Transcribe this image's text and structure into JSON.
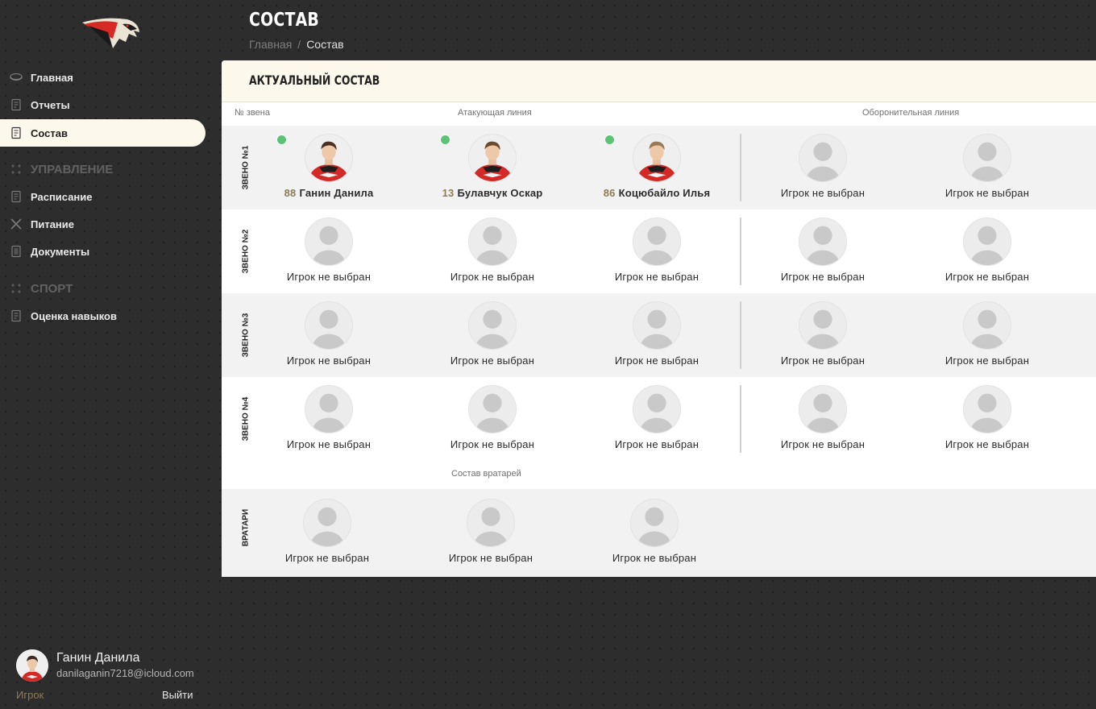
{
  "colors": {
    "accent": "#fdf8ec",
    "number": "#8d7b55",
    "online": "#5ec276",
    "background": "#2d2d2d"
  },
  "sidebar": {
    "logo_icon": "hawk-logo-icon",
    "items_top": [
      {
        "label": "Главная",
        "icon": "puck-icon"
      },
      {
        "label": "Отчеты",
        "icon": "report-icon"
      },
      {
        "label": "Состав",
        "icon": "roster-icon",
        "active": true
      }
    ],
    "section_management": {
      "title": "УПРАВЛЕНИЕ",
      "icon": "dots-icon"
    },
    "items_management": [
      {
        "label": "Расписание",
        "icon": "schedule-icon"
      },
      {
        "label": "Питание",
        "icon": "cutlery-icon"
      },
      {
        "label": "Документы",
        "icon": "document-icon"
      }
    ],
    "section_sport": {
      "title": "СПОРТ",
      "icon": "dots-icon"
    },
    "items_sport": [
      {
        "label": "Оценка навыков",
        "icon": "skills-icon"
      }
    ]
  },
  "user": {
    "name": "Ганин Данила",
    "email": "danilaganin7218@icloud.com",
    "role": "Игрок",
    "logout_label": "Выйти"
  },
  "header": {
    "title": "СОСТАВ",
    "breadcrumb": {
      "home": "Главная",
      "separator": "/",
      "current": "Состав"
    }
  },
  "card": {
    "title": "АКТУАЛЬНЫЙ СОСТАВ",
    "col_unit": "№ звена",
    "col_attack": "Атакующая линия",
    "col_defense": "Оборонительная линия",
    "goalie_section": "Состав вратарей",
    "empty_label": "Игрок не выбран",
    "lines": [
      {
        "label": "ЗВЕНО №1",
        "attack": [
          {
            "number": "88",
            "name": "Ганин Данила",
            "online": true
          },
          {
            "number": "13",
            "name": "Булавчук Оскар",
            "online": true
          },
          {
            "number": "86",
            "name": "Коцюбайло Илья",
            "online": true
          }
        ],
        "defense": [
          {
            "empty": true
          },
          {
            "empty": true
          }
        ]
      },
      {
        "label": "ЗВЕНО №2",
        "attack": [
          {
            "empty": true
          },
          {
            "empty": true
          },
          {
            "empty": true
          }
        ],
        "defense": [
          {
            "empty": true
          },
          {
            "empty": true
          }
        ]
      },
      {
        "label": "ЗВЕНО №3",
        "attack": [
          {
            "empty": true
          },
          {
            "empty": true
          },
          {
            "empty": true
          }
        ],
        "defense": [
          {
            "empty": true
          },
          {
            "empty": true
          }
        ]
      },
      {
        "label": "ЗВЕНО №4",
        "attack": [
          {
            "empty": true
          },
          {
            "empty": true
          },
          {
            "empty": true
          }
        ],
        "defense": [
          {
            "empty": true
          },
          {
            "empty": true
          }
        ]
      }
    ],
    "goalies": {
      "label": "ВРАТАРИ",
      "slots": [
        {
          "empty": true
        },
        {
          "empty": true
        },
        {
          "empty": true
        }
      ]
    }
  }
}
